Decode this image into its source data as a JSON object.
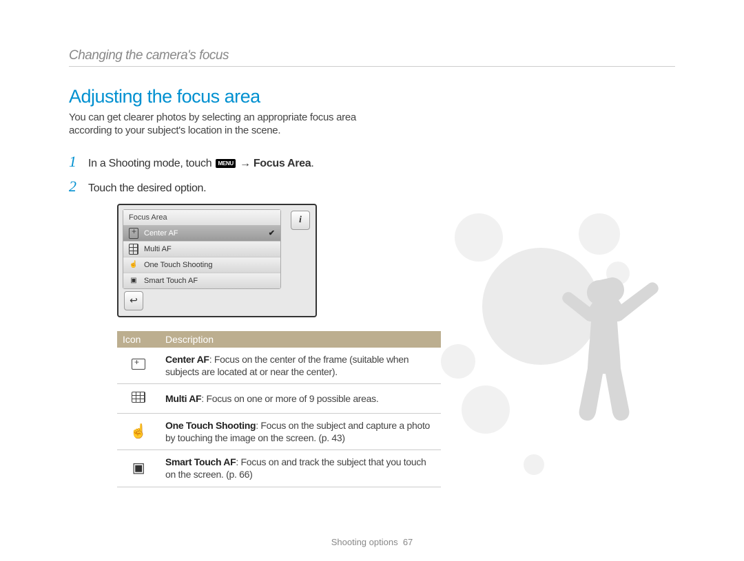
{
  "breadcrumb": "Changing the camera's focus",
  "section_title": "Adjusting the focus area",
  "intro": "You can get clearer photos by selecting an appropriate focus area according to your subject's location in the scene.",
  "step1_num": "1",
  "step1_pre": "In a Shooting mode, touch ",
  "step1_menu_chip": "MENU",
  "step1_arrow": " → ",
  "step1_bold": "Focus Area",
  "step1_period": ".",
  "step2_num": "2",
  "step2_text": "Touch the desired option.",
  "lcd": {
    "title": "Focus Area",
    "items": [
      {
        "icon": "center",
        "label": "Center AF",
        "selected": true
      },
      {
        "icon": "grid",
        "label": "Multi AF"
      },
      {
        "icon": "touch",
        "label": "One Touch Shooting"
      },
      {
        "icon": "smart",
        "label": "Smart Touch AF"
      }
    ],
    "info_glyph": "i",
    "back_glyph": "↩"
  },
  "table": {
    "h_icon": "Icon",
    "h_desc": "Description",
    "rows": [
      {
        "icon": "center",
        "title": "Center AF",
        "body": ": Focus on the center of the frame (suitable when subjects are located at or near the center)."
      },
      {
        "icon": "grid",
        "title": "Multi AF",
        "body": ": Focus on one or more of 9 possible areas."
      },
      {
        "icon": "touch",
        "title": "One Touch Shooting",
        "body": ": Focus on the subject and capture a photo by touching the image on the screen. (p. 43)"
      },
      {
        "icon": "smart",
        "title": "Smart Touch AF",
        "body": ": Focus on and track the subject that you touch on the screen. (p. 66)"
      }
    ]
  },
  "footer_section": "Shooting options",
  "footer_page": "67"
}
